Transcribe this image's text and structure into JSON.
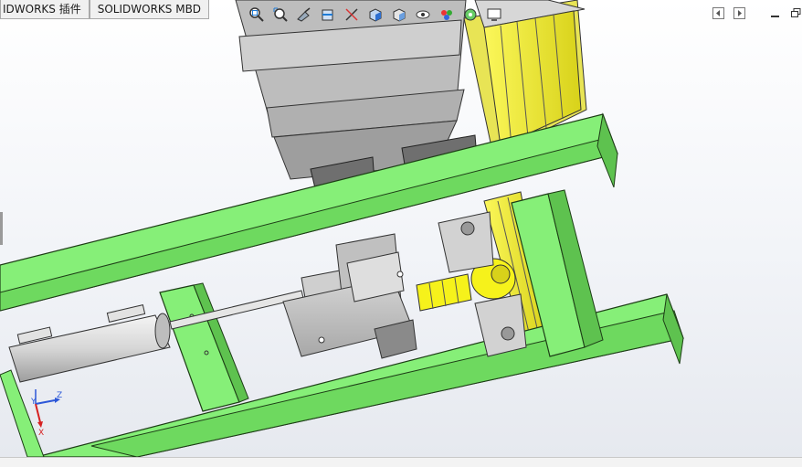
{
  "tabs": [
    {
      "label": "IDWORKS 插件"
    },
    {
      "label": "SOLIDWORKS MBD"
    }
  ],
  "heads_up_toolbar": [
    {
      "icon": "zoom-to-fit-icon"
    },
    {
      "icon": "zoom-to-area-icon"
    },
    {
      "icon": "previous-view-icon"
    },
    {
      "icon": "section-view-icon"
    },
    {
      "icon": "dynamic-annotation-icon"
    },
    {
      "icon": "view-orientation-icon"
    },
    {
      "icon": "display-style-icon"
    },
    {
      "icon": "hide-show-items-icon"
    },
    {
      "icon": "edit-appearance-icon"
    },
    {
      "icon": "apply-scene-icon"
    },
    {
      "icon": "view-settings-icon"
    }
  ],
  "window_controls": [
    {
      "icon": "previous-panel-icon"
    },
    {
      "icon": "next-panel-icon"
    },
    {
      "icon": "minimize-icon"
    },
    {
      "icon": "restore-icon"
    }
  ],
  "triad": {
    "x_label": "X",
    "y_label": "Y",
    "z_label": "Z"
  },
  "colors": {
    "frame_green": "#86ef78",
    "rail_yellow": "#f2ef2a",
    "housing_gray": "#c8c8c8",
    "shaft_yellow": "#f6f21b"
  }
}
